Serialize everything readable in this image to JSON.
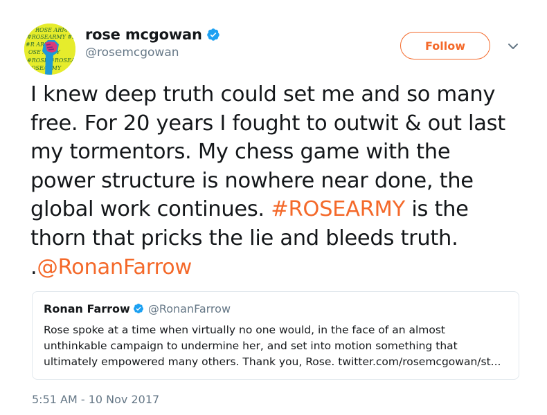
{
  "author": {
    "display_name": "rose mcgowan",
    "handle": "@rosemcgowan",
    "verified": true,
    "avatar_icon": "rosearmy-fist-avatar"
  },
  "actions": {
    "follow_label": "Follow",
    "more_icon": "chevron-down-icon"
  },
  "tweet": {
    "lines": [
      "I knew deep truth could set me and so many",
      "free. For 20 years I fought to outwit & out last",
      "my tormentors. My chess game with the",
      "power structure is nowhere near done, the"
    ],
    "line5_before": "global work continues. ",
    "hashtag": "#ROSEARMY",
    "line5_after": " is the",
    "line6": "thorn that pricks the lie and bleeds truth.",
    "line7_prefix": ".",
    "mention": "@RonanFarrow"
  },
  "quoted_tweet": {
    "display_name": "Ronan Farrow",
    "handle": "@RonanFarrow",
    "verified": true,
    "lines": [
      "Rose spoke at a time when virtually no one would, in the face of an almost",
      "unthinkable campaign to undermine her, and set into motion something that",
      "ultimately empowered many others. Thank you, Rose. twitter.com/rosemcgowan/st..."
    ]
  },
  "timestamp": "5:51 AM - 10 Nov 2017",
  "colors": {
    "accent": "#f4692a",
    "verified": "#1da1f2",
    "secondary_text": "#657786",
    "border": "#e1e8ed"
  }
}
